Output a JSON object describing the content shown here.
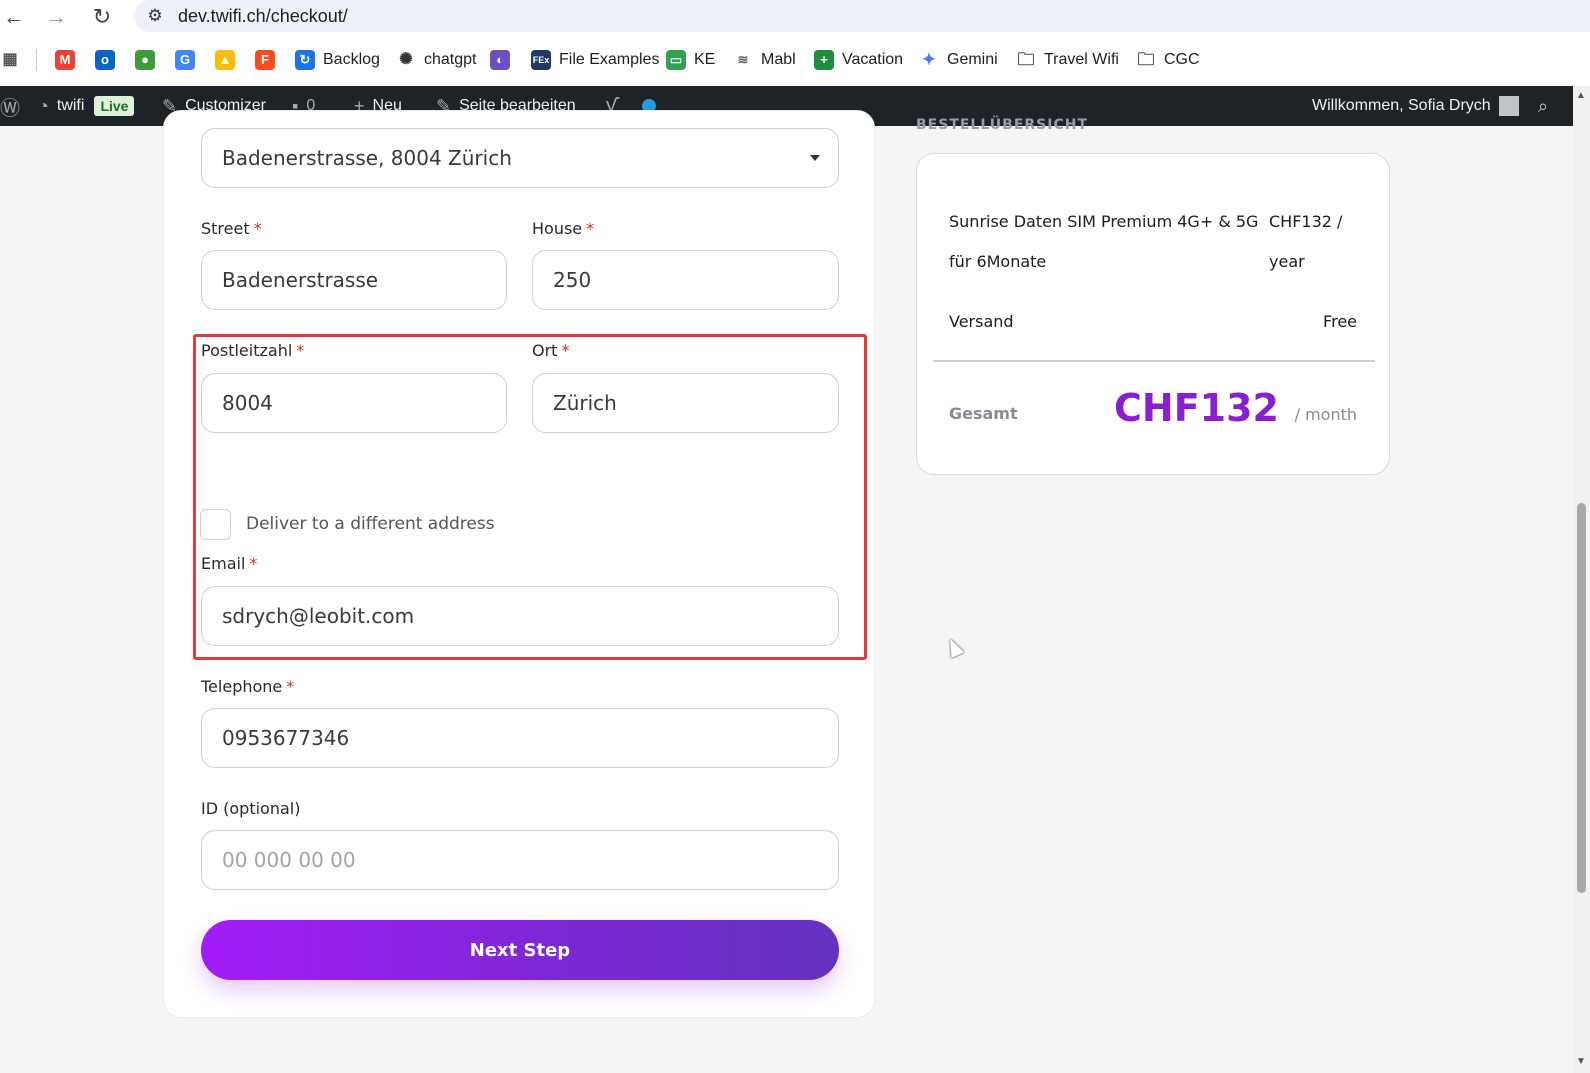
{
  "browser": {
    "url": "dev.twifi.ch/checkout/",
    "back_icon": "←",
    "forward_icon": "→",
    "reload_icon": "↻",
    "site_info_icon": "⚙"
  },
  "bookmarks": [
    {
      "label": "",
      "icon": "gmail-icon"
    },
    {
      "label": "",
      "icon": "outlook-icon"
    },
    {
      "label": "",
      "icon": "frog-icon"
    },
    {
      "label": "",
      "icon": "translate-icon"
    },
    {
      "label": "",
      "icon": "drive-icon"
    },
    {
      "label": "",
      "icon": "figma-icon"
    },
    {
      "label": "Backlog",
      "icon": "backlog-icon"
    },
    {
      "label": "chatgpt",
      "icon": "chatgpt-icon"
    },
    {
      "label": "",
      "icon": "planet-icon"
    },
    {
      "label": "File Examples",
      "icon": "fex-icon",
      "icon_text": "FEx"
    },
    {
      "label": "KE",
      "icon": "ke-icon"
    },
    {
      "label": "Mabl",
      "icon": "mabl-icon"
    },
    {
      "label": "Vacation",
      "icon": "sheets-icon"
    },
    {
      "label": "Gemini",
      "icon": "gemini-icon"
    },
    {
      "label": "Travel Wifi",
      "icon": "folder-icon"
    },
    {
      "label": "CGC",
      "icon": "folder-icon"
    }
  ],
  "admin_bar": {
    "site_name": "twifi",
    "live_badge": "Live",
    "customizer": "Customizer",
    "comments_count": "0",
    "new": "Neu",
    "edit_page": "Seite bearbeiten",
    "welcome": "Willkommen, Sofia Drych"
  },
  "form": {
    "address_select": "Badenerstrasse, 8004 Zürich",
    "street_label": "Street",
    "street_value": "Badenerstrasse",
    "house_label": "House",
    "house_value": "250",
    "plz_label": "Postleitzahl",
    "plz_value": "8004",
    "ort_label": "Ort",
    "ort_value": "Zürich",
    "different_address_label": "Deliver to a different address",
    "email_label": "Email",
    "email_value": "sdrych@leobit.com",
    "telephone_label": "Telephone",
    "telephone_value": "0953677346",
    "id_label": "ID (optional)",
    "id_placeholder": "00 000 00 00",
    "required_mark": "*",
    "next_button": "Next Step"
  },
  "summary": {
    "title": "BESTELLÜBERSICHT",
    "product_name_line1": "Sunrise Daten SIM Premium 4G+ & 5G",
    "product_name_line2": "für 6Monate",
    "product_price_line1": "CHF132 /",
    "product_price_line2": "year",
    "shipping_label": "Versand",
    "shipping_value": "Free",
    "total_label": "Gesamt",
    "total_value": "CHF132",
    "total_period": "/ month"
  },
  "colors": {
    "accent": "#8a1fd0",
    "highlight_border": "#e03a3a",
    "admin_bar": "#1d2327"
  }
}
